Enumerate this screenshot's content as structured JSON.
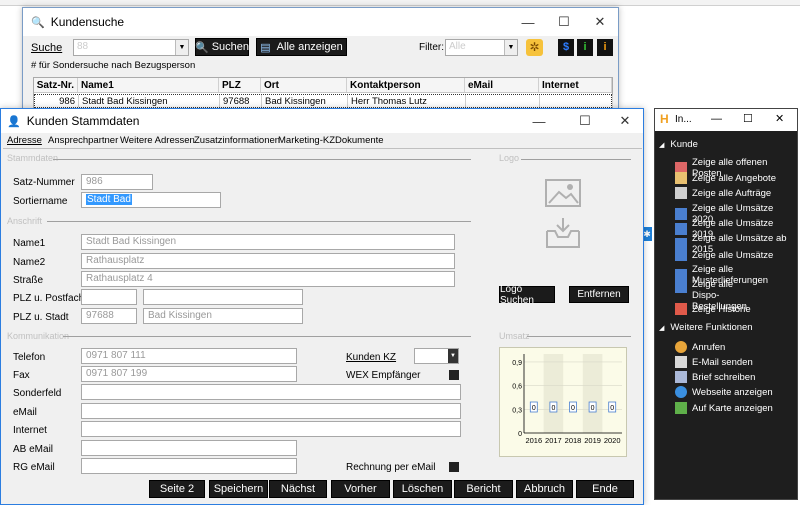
{
  "search_window": {
    "title": "Kundensuche",
    "search_label": "Suche",
    "search_value": "88",
    "search_button": "Suchen",
    "show_all_button": "Alle anzeigen",
    "filter_label": "Filter:",
    "filter_value": "Alle",
    "hint": "# für Sondersuche nach Bezugsperson",
    "columns": [
      "Satz-Nr.",
      "Name1",
      "PLZ",
      "Ort",
      "Kontaktperson",
      "eMail",
      "Internet"
    ],
    "rows": [
      {
        "satznr": "986",
        "name1": "Stadt Bad Kissingen",
        "plz": "97688",
        "ort": "Bad Kissingen",
        "kontakt": "Herr Thomas Lutz",
        "email": "",
        "internet": ""
      }
    ]
  },
  "main_window": {
    "title": "Kunden Stammdaten",
    "tabs": [
      "Adresse",
      "Ansprechpartner",
      "Weitere Adressen",
      "Zusatzinformationen",
      "Marketing-KZ",
      "Dokumente"
    ],
    "section_headers": [
      "Stammdaten",
      "Anschrift",
      "Kommunikation",
      "Logo",
      "Umsatz"
    ],
    "satznr_label": "Satz-Nummer",
    "satznr_value": "986",
    "sortiername_label": "Sortiername",
    "sortiername_value": "Stadt Bad",
    "name1_label": "Name1",
    "name1_value": "Stadt Bad Kissingen",
    "name2_label": "Name2",
    "name2_value": "Rathausplatz",
    "strasse_label": "Straße",
    "strasse_value": "Rathausplatz 4",
    "plz_postfach_label": "PLZ u. Postfach",
    "plz_stadt_label": "PLZ u. Stadt",
    "plz_value": "97688",
    "stadt_value": "Bad Kissingen",
    "telefon_label": "Telefon",
    "telefon_value": "0971 807 111",
    "fax_label": "Fax",
    "fax_value": "0971 807 199",
    "sonderfeld_label": "Sonderfeld",
    "email_label": "eMail",
    "internet_label": "Internet",
    "ab_email_label": "AB eMail",
    "rg_email_label": "RG eMail",
    "kunden_kz_label": "Kunden KZ",
    "wex_label": "WEX Empfänger",
    "rechnung_email_label": "Rechnung per eMail",
    "logo_search_button": "Logo Suchen",
    "remove_button": "Entfernen",
    "bottom_buttons": [
      "Seite 2",
      "Speichern",
      "Nächst",
      "Vorher",
      "Löschen",
      "Bericht",
      "Abbruch",
      "Ende"
    ]
  },
  "chart_data": {
    "type": "bar",
    "categories": [
      "2016",
      "2017",
      "2018",
      "2019",
      "2020"
    ],
    "values": [
      0,
      0,
      0,
      0,
      0
    ],
    "data_labels": [
      "0",
      "0",
      "0",
      "0",
      "0"
    ],
    "title": "",
    "xlabel": "",
    "ylabel": "",
    "ylim": [
      0,
      1
    ],
    "yticks": [
      "0",
      "0,3",
      "0,6",
      "0,9"
    ],
    "grid": true
  },
  "side_panel": {
    "title": "In...",
    "group1": "Kunde",
    "items1": [
      "Zeige alle offenen Posten",
      "Zeige alle Angebote",
      "Zeige alle Aufträge",
      "Zeige alle Umsätze 2020",
      "Zeige alle Umsätze 2019",
      "Zeige alle Umsätze ab 2015",
      "Zeige alle Umsätze",
      "Zeige alle Musterlieferungen",
      "Zeige alle Dispo-Bestellungen",
      "Zeige Historie"
    ],
    "group2": "Weitere Funktionen",
    "items2": [
      "Anrufen",
      "E-Mail senden",
      "Brief schreiben",
      "Webseite anzeigen",
      "Auf Karte anzeigen"
    ]
  },
  "colors": {
    "accent": "#0078d7",
    "selection": "#3399ff",
    "dark_panel": "#1e1e1e",
    "chart_bg": "#fbfbe8"
  }
}
